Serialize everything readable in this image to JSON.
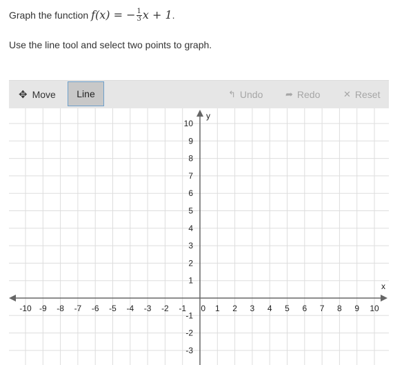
{
  "prompt": {
    "lead": "Graph the function ",
    "fn_name": "f(x)",
    "equals": " = −",
    "frac_num": "1",
    "frac_den": "3",
    "rest": "x + 1",
    "period": "."
  },
  "instruction": "Use the line tool and select two points to graph.",
  "toolbar": {
    "move_label": "Move",
    "line_label": "Line",
    "undo_label": "Undo",
    "redo_label": "Redo",
    "reset_label": "Reset",
    "active_tool": "Line",
    "icons": {
      "move": "move-arrows-icon",
      "undo": "undo-arrow-icon",
      "redo": "redo-arrow-icon",
      "reset": "close-x-icon"
    }
  },
  "graph": {
    "x_axis_label": "x",
    "y_axis_label": "y",
    "x_ticks": [
      "-10",
      "-9",
      "-8",
      "-7",
      "-6",
      "-5",
      "-4",
      "-3",
      "-2",
      "-1",
      "1",
      "2",
      "3",
      "4",
      "5",
      "6",
      "7",
      "8",
      "9",
      "10"
    ],
    "y_ticks": [
      "10",
      "9",
      "8",
      "7",
      "6",
      "5",
      "4",
      "3",
      "2",
      "1",
      "-1",
      "-2",
      "-3"
    ],
    "origin_label": "0",
    "x_range": [
      -10,
      10
    ],
    "y_range_visible": [
      -3.5,
      10
    ],
    "grid": true,
    "colors": {
      "grid": "#dddddd",
      "axis": "#666666"
    }
  }
}
